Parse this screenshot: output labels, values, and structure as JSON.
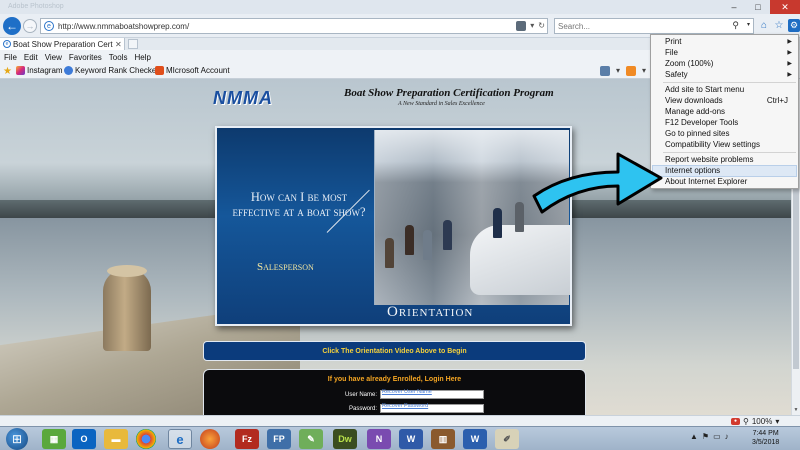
{
  "window": {
    "ghost_title": "Adobe Photoshop"
  },
  "browser": {
    "url": "http://www.nmmaboatshowprep.com/",
    "search_placeholder": "Search...",
    "tab_label": "Boat Show Preparation Certif...",
    "menu": [
      "File",
      "Edit",
      "View",
      "Favorites",
      "Tools",
      "Help"
    ],
    "favorites": [
      "Instagram",
      "Keyword Rank Checker",
      "MIcrosoft Account"
    ],
    "zoom_level": "100%"
  },
  "page": {
    "logo": "NMMA",
    "program_title": "Boat Show Preparation Certification Program",
    "tagline": "A New Standard in Sales Excellence",
    "video": {
      "question": "How can I be most effective at a boat show?",
      "salesperson": "Salesperson",
      "orientation": "Orientation"
    },
    "cta": "Click The Orientation Video Above to Begin",
    "login": {
      "heading": "If you have already Enrolled, Login Here",
      "username_label": "User Name:",
      "recover_username": "Recover User Name",
      "password_label": "Password:",
      "recover_password": "Recover Password"
    }
  },
  "tools_menu": {
    "submenus": [
      "Print",
      "File",
      "Zoom (100%)",
      "Safety"
    ],
    "group2": [
      "Add site to Start menu",
      "View downloads",
      "Manage add-ons",
      "F12 Developer Tools",
      "Go to pinned sites",
      "Compatibility View settings"
    ],
    "downloads_shortcut": "Ctrl+J",
    "group3": [
      "Report website problems",
      "Internet options",
      "About Internet Explorer"
    ],
    "highlighted": "Internet options"
  },
  "taskbar": {
    "clock_time": "7:44 PM",
    "clock_date": "3/5/2018",
    "apps": [
      "games",
      "outlook",
      "file-explorer",
      "chrome",
      "internet-explorer",
      "firefox",
      "filezilla",
      "ftp",
      "maps",
      "dreamweaver",
      "onenote",
      "word",
      "library",
      "word-doc",
      "notepad"
    ]
  },
  "colors": {
    "arrow_fill": "#2ec3f0",
    "cta_text": "#f5d13b",
    "login_heading": "#f5a623",
    "video_bg": "#15579a"
  }
}
